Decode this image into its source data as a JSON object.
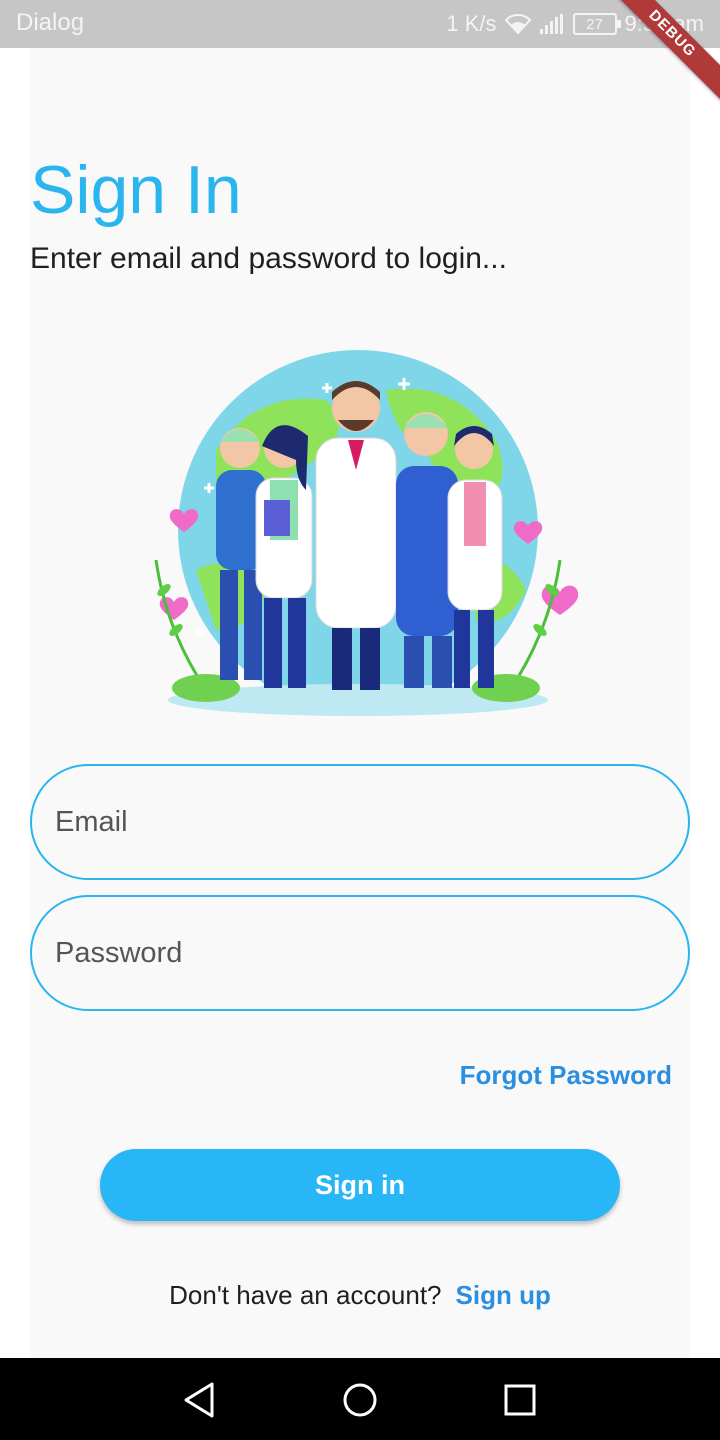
{
  "status_bar": {
    "app_name": "Dialog",
    "network_speed": "1 K/s",
    "battery_level": "27",
    "time": "9:54 am"
  },
  "debug_banner": "DEBUG",
  "login": {
    "title": "Sign In",
    "subtitle": "Enter email and password to login...",
    "email_placeholder": "Email",
    "password_placeholder": "Password",
    "forgot_password": "Forgot Password",
    "sign_in_button": "Sign in",
    "no_account_text": "Don't have an account?",
    "sign_up_link": "Sign up"
  },
  "colors": {
    "accent": "#2ab5ee",
    "button": "#29b6f6",
    "link": "#2a8fe0",
    "status_bar": "#c6c6c6",
    "nav_bar": "#000000"
  },
  "icons": {
    "wifi": "wifi-icon",
    "signal": "signal-icon",
    "battery": "battery-icon",
    "back": "back-triangle-icon",
    "home": "home-circle-icon",
    "recent": "recent-square-icon"
  }
}
